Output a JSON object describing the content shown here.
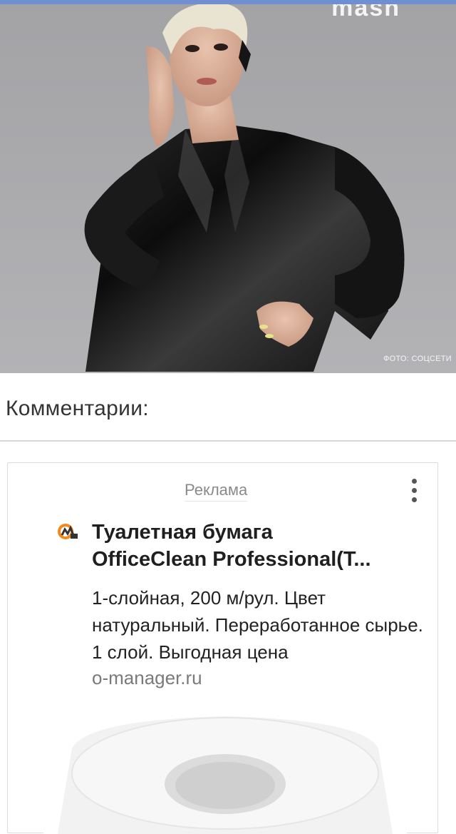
{
  "hero": {
    "watermark_top": "mash",
    "photo_credit": "ФОТО: СОЦСЕТИ"
  },
  "comments": {
    "title": "Комментарии:"
  },
  "ad": {
    "label": "Реклама",
    "logo_icon": "office-manager-logo-icon",
    "title_line1": "Туалетная бумага",
    "title_line2": "OfficeClean Professional(Т...",
    "description": "1-слойная, 200 м/рул. Цвет натуральный. Переработанное сырье. 1 слой. Выгодная цена",
    "domain": "o-manager.ru",
    "menu_icon": "more-vertical-icon"
  },
  "colors": {
    "top_strip": "#6f8fd0",
    "hero_background": "#aaaaad",
    "title_text": "#1f1f1f",
    "domain_text": "#7a7a7a",
    "logo_orange": "#f28a1a"
  }
}
